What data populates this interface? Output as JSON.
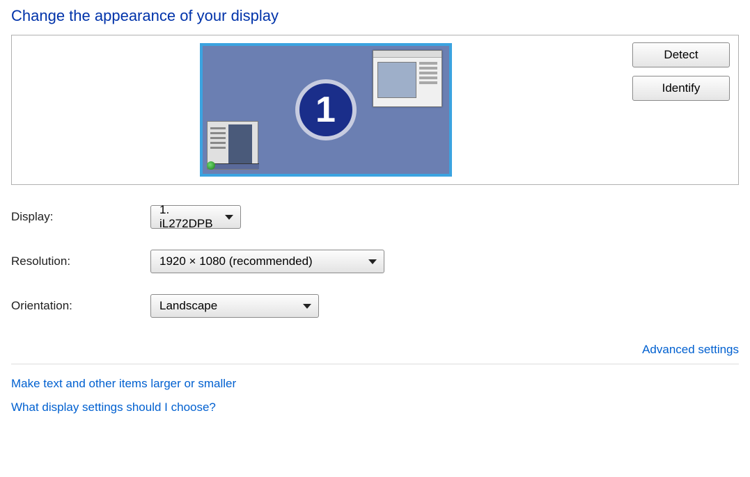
{
  "title": "Change the appearance of your display",
  "monitor_number": "1",
  "buttons": {
    "detect": "Detect",
    "identify": "Identify"
  },
  "fields": {
    "display": {
      "label": "Display:",
      "value": "1. iL272DPB"
    },
    "resolution": {
      "label": "Resolution:",
      "value": "1920 × 1080 (recommended)"
    },
    "orientation": {
      "label": "Orientation:",
      "value": "Landscape"
    }
  },
  "links": {
    "advanced": "Advanced settings",
    "textsize": "Make text and other items larger or smaller",
    "help": "What display settings should I choose?"
  }
}
